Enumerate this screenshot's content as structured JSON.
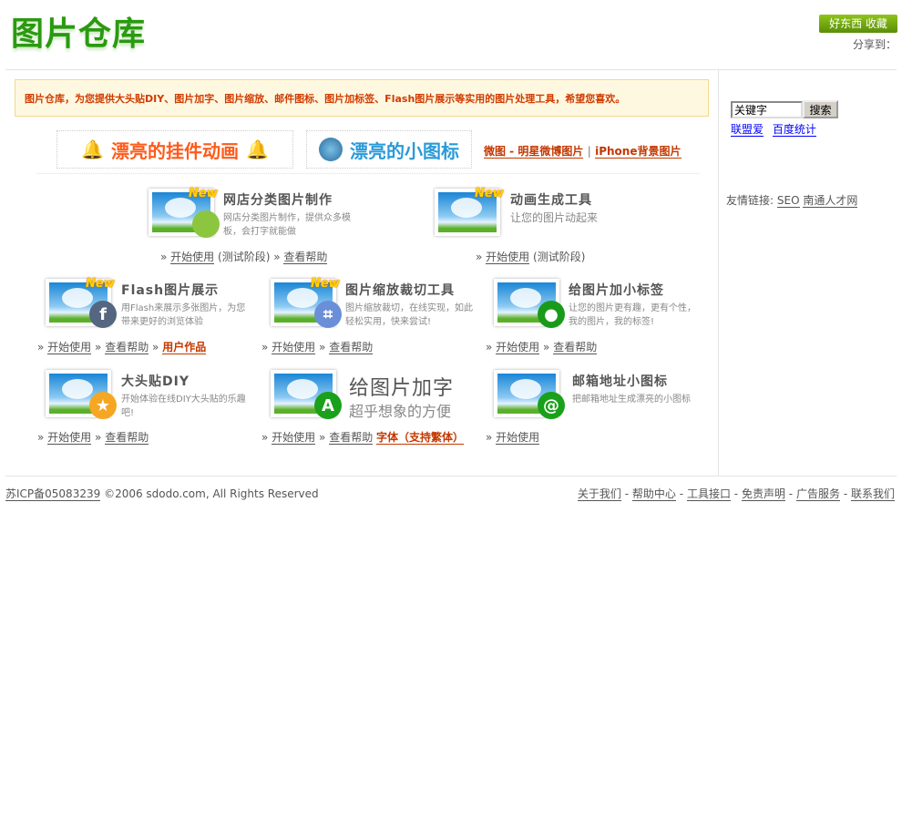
{
  "header": {
    "logo": "图片仓库",
    "fav_button": "好东西 收藏",
    "share_label": "分享到："
  },
  "notice": "图片仓库，为您提供大头贴DIY、图片加字、图片缩放、邮件图标、图片加标签、Flash图片展示等实用的图片处理工具，希望您喜欢。",
  "banners": [
    {
      "text": "漂亮的挂件动画",
      "color": "#ff5a1a"
    },
    {
      "text": "漂亮的小图标",
      "color": "#2a9ad8"
    }
  ],
  "top_links": [
    "微图 - 明星微博图片",
    "iPhone背景图片"
  ],
  "top_links_sep": "|",
  "tools": [
    {
      "title": "网店分类图片制作",
      "desc": "网店分类图片制作，提供众多模板，会打字就能做",
      "new": "New",
      "links": [
        "开始使用",
        "查看帮助"
      ],
      "note": "(测试阶段)",
      "badge": "picture-icon",
      "badge_color": "#8cc63f"
    },
    {
      "title": "动画生成工具",
      "desc": "让您的图片动起来",
      "new": "New",
      "links": [
        "开始使用"
      ],
      "note": "(测试阶段)"
    },
    {
      "title": "Flash图片展示",
      "desc": "用Flash来展示多张图片，为您带来更好的浏览体验",
      "new": "New",
      "links": [
        "开始使用",
        "查看帮助",
        "用户作品"
      ],
      "badge": "flash-icon",
      "badge_color": "#556680",
      "badge_text": "f"
    },
    {
      "title": "图片缩放裁切工具",
      "desc": "图片缩放裁切，在线实现，如此轻松实用，快来尝试!",
      "new": "New",
      "links": [
        "开始使用",
        "查看帮助"
      ],
      "badge": "crop-icon",
      "badge_color": "#6a8fd8",
      "badge_text": "⌗"
    },
    {
      "title": "给图片加小标签",
      "desc": "让您的图片更有趣，更有个性，我的图片，我的标签!",
      "links": [
        "开始使用",
        "查看帮助"
      ],
      "badge": "tag-icon",
      "badge_color": "#1a9a1a",
      "badge_text": "●"
    },
    {
      "title": "大头贴DIY",
      "desc": "开始体验在线DIY大头贴的乐趣吧!",
      "links": [
        "开始使用",
        "查看帮助"
      ],
      "badge": "photo-sticker-icon",
      "badge_color": "#f5a623",
      "badge_text": "★"
    },
    {
      "title": "给图片加字",
      "desc": "超乎想象的方便",
      "links": [
        "开始使用",
        "查看帮助",
        "字体（支持繁体）"
      ],
      "badge": "letter-a-icon",
      "badge_color": "#1aa01a",
      "badge_text": "A"
    },
    {
      "title": "邮箱地址小图标",
      "desc": "把邮箱地址生成漂亮的小图标",
      "links": [
        "开始使用"
      ],
      "badge": "at-icon",
      "badge_color": "#1aa01a",
      "badge_text": "@"
    }
  ],
  "link_arrow": "»",
  "sidebar": {
    "search_placeholder": "关键字",
    "search_button": "搜索",
    "links": [
      "联盟爱",
      "百度统计"
    ],
    "friends_label": "友情链接:",
    "friends": [
      "SEO",
      "南通人才网"
    ]
  },
  "footer": {
    "icp": "苏ICP备05083239",
    "copyright": "©2006 sdodo.com, All Rights Reserved",
    "links": [
      "关于我们",
      "帮助中心",
      "工具接口",
      "免责声明",
      "广告服务",
      "联系我们"
    ],
    "sep": "-"
  }
}
